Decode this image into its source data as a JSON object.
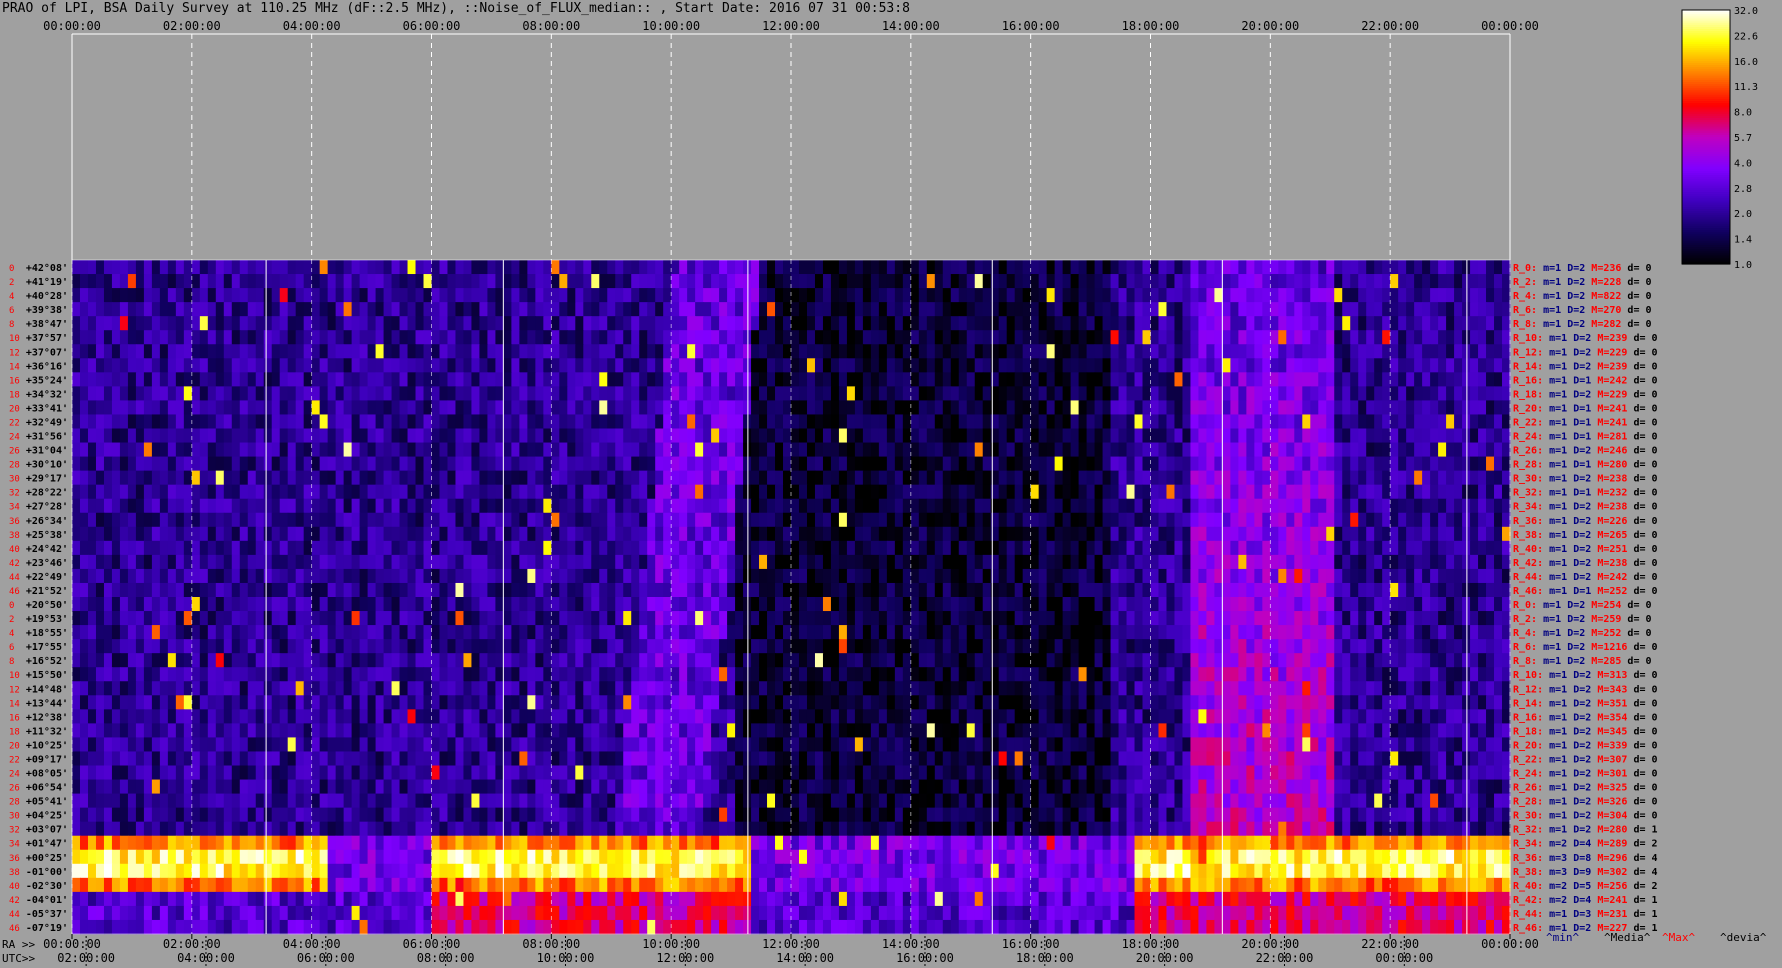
{
  "title": "PRAO of LPI, BSA Daily Survey at 110.25 MHz (dF::2.5 MHz), ::Noise_of_FLUX_median:: , Start Date: 2016 07 31 00:53:8",
  "chart_data": {
    "type": "heatmap",
    "title": "PRAO of LPI, BSA Daily Survey at 110.25 MHz (dF::2.5 MHz), ::Noise_of_FLUX_median:: , Start Date: 2016 07 31 00:53:8",
    "top_time_ticks": [
      "00:00:00",
      "02:00:00",
      "04:00:00",
      "06:00:00",
      "08:00:00",
      "10:00:00",
      "12:00:00",
      "14:00:00",
      "16:00:00",
      "18:00:00",
      "20:00:00",
      "22:00:00",
      "00:00:00"
    ],
    "ra_label": "RA >>",
    "ra_ticks": [
      "00:00:00",
      "02:00:00",
      "04:00:00",
      "06:00:00",
      "08:00:00",
      "10:00:00",
      "12:00:00",
      "14:00:00",
      "16:00:00",
      "18:00:00",
      "20:00:00",
      "22:00:00",
      "00:00:00"
    ],
    "utc_label": "UTC>>",
    "utc_ticks": [
      "02:00:00",
      "04:00:00",
      "06:00:00",
      "08:00:00",
      "10:00:00",
      "12:00:00",
      "14:00:00",
      "16:00:00",
      "18:00:00",
      "20:00:00",
      "22:00:00",
      "00:00:00"
    ],
    "declinations": [
      "+42°08'",
      "+41°19'",
      "+40°28'",
      "+39°38'",
      "+38°47'",
      "+37°57'",
      "+37°07'",
      "+36°16'",
      "+35°24'",
      "+34°32'",
      "+33°41'",
      "+32°49'",
      "+31°56'",
      "+31°04'",
      "+30°10'",
      "+29°17'",
      "+28°22'",
      "+27°28'",
      "+26°34'",
      "+25°38'",
      "+24°42'",
      "+23°46'",
      "+22°49'",
      "+21°52'",
      "+20°50'",
      "+19°53'",
      "+18°55'",
      "+17°55'",
      "+16°52'",
      "+15°50'",
      "+14°48'",
      "+13°44'",
      "+12°38'",
      "+11°32'",
      "+10°25'",
      "+09°17'",
      "+08°05'",
      "+06°54'",
      "+05°41'",
      "+04°25'",
      "+03°07'",
      "+01°47'",
      "+00°25'",
      "-01°00'",
      "-02°30'",
      "-04°01'",
      "-05°37'",
      "-07°19'"
    ],
    "row_numbers": [
      "0",
      "2",
      "4",
      "6",
      "8",
      "10",
      "12",
      "14",
      "16",
      "18",
      "20",
      "22",
      "24",
      "26",
      "28",
      "30",
      "32",
      "34",
      "36",
      "38",
      "40",
      "42",
      "44",
      "46",
      "0",
      "2",
      "4",
      "6",
      "8",
      "10",
      "12",
      "14",
      "16",
      "18",
      "20",
      "22",
      "24",
      "26",
      "28",
      "30",
      "32",
      "34",
      "36",
      "38",
      "40",
      "42",
      "44",
      "46"
    ],
    "stats": [
      {
        "r": "R_0:",
        "m": "m=1",
        "D": "D=2",
        "M": "M=236",
        "d": "d= 0"
      },
      {
        "r": "R_2:",
        "m": "m=1",
        "D": "D=2",
        "M": "M=228",
        "d": "d= 0"
      },
      {
        "r": "R_4:",
        "m": "m=1",
        "D": "D=2",
        "M": "M=822",
        "d": "d= 0"
      },
      {
        "r": "R_6:",
        "m": "m=1",
        "D": "D=2",
        "M": "M=270",
        "d": "d= 0"
      },
      {
        "r": "R_8:",
        "m": "m=1",
        "D": "D=2",
        "M": "M=282",
        "d": "d= 0"
      },
      {
        "r": "R_10:",
        "m": "m=1",
        "D": "D=2",
        "M": "M=239",
        "d": "d= 0"
      },
      {
        "r": "R_12:",
        "m": "m=1",
        "D": "D=2",
        "M": "M=229",
        "d": "d= 0"
      },
      {
        "r": "R_14:",
        "m": "m=1",
        "D": "D=2",
        "M": "M=239",
        "d": "d= 0"
      },
      {
        "r": "R_16:",
        "m": "m=1",
        "D": "D=1",
        "M": "M=242",
        "d": "d= 0"
      },
      {
        "r": "R_18:",
        "m": "m=1",
        "D": "D=2",
        "M": "M=229",
        "d": "d= 0"
      },
      {
        "r": "R_20:",
        "m": "m=1",
        "D": "D=1",
        "M": "M=241",
        "d": "d= 0"
      },
      {
        "r": "R_22:",
        "m": "m=1",
        "D": "D=1",
        "M": "M=241",
        "d": "d= 0"
      },
      {
        "r": "R_24:",
        "m": "m=1",
        "D": "D=1",
        "M": "M=281",
        "d": "d= 0"
      },
      {
        "r": "R_26:",
        "m": "m=1",
        "D": "D=2",
        "M": "M=246",
        "d": "d= 0"
      },
      {
        "r": "R_28:",
        "m": "m=1",
        "D": "D=1",
        "M": "M=280",
        "d": "d= 0"
      },
      {
        "r": "R_30:",
        "m": "m=1",
        "D": "D=2",
        "M": "M=238",
        "d": "d= 0"
      },
      {
        "r": "R_32:",
        "m": "m=1",
        "D": "D=1",
        "M": "M=232",
        "d": "d= 0"
      },
      {
        "r": "R_34:",
        "m": "m=1",
        "D": "D=2",
        "M": "M=238",
        "d": "d= 0"
      },
      {
        "r": "R_36:",
        "m": "m=1",
        "D": "D=2",
        "M": "M=226",
        "d": "d= 0"
      },
      {
        "r": "R_38:",
        "m": "m=1",
        "D": "D=2",
        "M": "M=265",
        "d": "d= 0"
      },
      {
        "r": "R_40:",
        "m": "m=1",
        "D": "D=2",
        "M": "M=251",
        "d": "d= 0"
      },
      {
        "r": "R_42:",
        "m": "m=1",
        "D": "D=2",
        "M": "M=238",
        "d": "d= 0"
      },
      {
        "r": "R_44:",
        "m": "m=1",
        "D": "D=2",
        "M": "M=242",
        "d": "d= 0"
      },
      {
        "r": "R_46:",
        "m": "m=1",
        "D": "D=1",
        "M": "M=252",
        "d": "d= 0"
      },
      {
        "r": "R_0:",
        "m": "m=1",
        "D": "D=2",
        "M": "M=254",
        "d": "d= 0"
      },
      {
        "r": "R_2:",
        "m": "m=1",
        "D": "D=2",
        "M": "M=259",
        "d": "d= 0"
      },
      {
        "r": "R_4:",
        "m": "m=1",
        "D": "D=2",
        "M": "M=252",
        "d": "d= 0"
      },
      {
        "r": "R_6:",
        "m": "m=1",
        "D": "D=2",
        "M": "M=1216",
        "d": "d= 0"
      },
      {
        "r": "R_8:",
        "m": "m=1",
        "D": "D=2",
        "M": "M=285",
        "d": "d= 0"
      },
      {
        "r": "R_10:",
        "m": "m=1",
        "D": "D=2",
        "M": "M=313",
        "d": "d= 0"
      },
      {
        "r": "R_12:",
        "m": "m=1",
        "D": "D=2",
        "M": "M=343",
        "d": "d= 0"
      },
      {
        "r": "R_14:",
        "m": "m=1",
        "D": "D=2",
        "M": "M=351",
        "d": "d= 0"
      },
      {
        "r": "R_16:",
        "m": "m=1",
        "D": "D=2",
        "M": "M=354",
        "d": "d= 0"
      },
      {
        "r": "R_18:",
        "m": "m=1",
        "D": "D=2",
        "M": "M=345",
        "d": "d= 0"
      },
      {
        "r": "R_20:",
        "m": "m=1",
        "D": "D=2",
        "M": "M=339",
        "d": "d= 0"
      },
      {
        "r": "R_22:",
        "m": "m=1",
        "D": "D=2",
        "M": "M=307",
        "d": "d= 0"
      },
      {
        "r": "R_24:",
        "m": "m=1",
        "D": "D=2",
        "M": "M=301",
        "d": "d= 0"
      },
      {
        "r": "R_26:",
        "m": "m=1",
        "D": "D=2",
        "M": "M=325",
        "d": "d= 0"
      },
      {
        "r": "R_28:",
        "m": "m=1",
        "D": "D=2",
        "M": "M=326",
        "d": "d= 0"
      },
      {
        "r": "R_30:",
        "m": "m=1",
        "D": "D=2",
        "M": "M=304",
        "d": "d= 0"
      },
      {
        "r": "R_32:",
        "m": "m=1",
        "D": "D=2",
        "M": "M=280",
        "d": "d= 1"
      },
      {
        "r": "R_34:",
        "m": "m=2",
        "D": "D=4",
        "M": "M=289",
        "d": "d= 2"
      },
      {
        "r": "R_36:",
        "m": "m=3",
        "D": "D=8",
        "M": "M=296",
        "d": "d= 4"
      },
      {
        "r": "R_38:",
        "m": "m=3",
        "D": "D=9",
        "M": "M=302",
        "d": "d= 4"
      },
      {
        "r": "R_40:",
        "m": "m=2",
        "D": "D=5",
        "M": "M=256",
        "d": "d= 2"
      },
      {
        "r": "R_42:",
        "m": "m=2",
        "D": "D=4",
        "M": "M=241",
        "d": "d= 1"
      },
      {
        "r": "R_44:",
        "m": "m=1",
        "D": "D=3",
        "M": "M=231",
        "d": "d= 1"
      },
      {
        "r": "R_46:",
        "m": "m=1",
        "D": "D=2",
        "M": "M=227",
        "d": "d= 1"
      }
    ],
    "stat_legend": [
      "^min^",
      "^Media^",
      "^Max^",
      "^devia^"
    ],
    "colorbar_ticks": [
      "32.0",
      "22.6",
      "16.0",
      "11.3",
      "8.0",
      "5.7",
      "4.0",
      "2.8",
      "2.0",
      "1.4",
      "1.0"
    ],
    "colorbar_scale": "log",
    "colorbar_range": [
      1.0,
      32.0
    ],
    "colors": {
      "background": "#a0a0a0",
      "stat_R": "#ff0000",
      "stat_mD": "#000080",
      "stat_M": "#ff0000",
      "stat_d": "#000000",
      "row_numbers": "#ff0000",
      "colormap": [
        "#000000",
        "#100060",
        "#4000c0",
        "#8000ff",
        "#c000c0",
        "#ff0000",
        "#ff8000",
        "#ffff00",
        "#ffffff"
      ]
    }
  }
}
